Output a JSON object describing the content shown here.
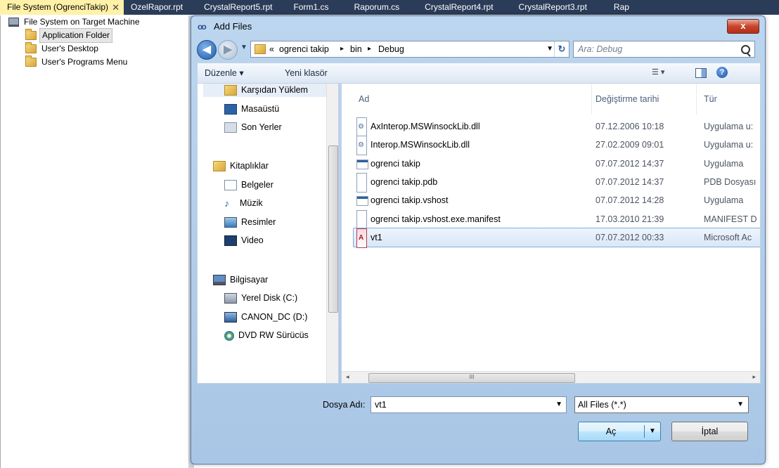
{
  "tabs": [
    {
      "label": "File System (OgrenciTakip)",
      "active": true
    },
    {
      "label": "OzelRapor.rpt"
    },
    {
      "label": "CrystalReport5.rpt"
    },
    {
      "label": "Form1.cs"
    },
    {
      "label": "Raporum.cs"
    },
    {
      "label": "CrystalReport4.rpt"
    },
    {
      "label": "CrystalReport3.rpt"
    },
    {
      "label": "Rap"
    }
  ],
  "tab_close_glyph": "✕",
  "tree": {
    "root": "File System on Target Machine",
    "items": [
      "Application Folder",
      "User's Desktop",
      "User's Programs Menu"
    ],
    "selected_index": 0
  },
  "dialog": {
    "title": "Add Files",
    "title_icon_glyph": "oo",
    "close_glyph": "x",
    "back_glyph": "◀",
    "forward_glyph": "▶",
    "breadcrumb": [
      "«",
      "ogrenci takip",
      "▸",
      "bin",
      "▸",
      "Debug"
    ],
    "search_placeholder": "Ara: Debug",
    "refresh_glyph": "↻",
    "command_bar": {
      "organize": "Düzenle ▾",
      "new_folder": "Yeni klasör",
      "views_glyph": "☰ ▾",
      "help_glyph": "?"
    },
    "nav_pane": [
      {
        "label": "Karşıdan Yüklem",
        "icon": "downloads-folder",
        "selected": true
      },
      {
        "label": "Masaüstü",
        "icon": "desktop"
      },
      {
        "label": "Son Yerler",
        "icon": "recent-places"
      },
      {
        "label": "Kitaplıklar",
        "icon": "libraries"
      },
      {
        "label": "Belgeler",
        "icon": "documents"
      },
      {
        "label": "Müzik",
        "icon": "music"
      },
      {
        "label": "Resimler",
        "icon": "pictures"
      },
      {
        "label": "Video",
        "icon": "video"
      },
      {
        "label": "Bilgisayar",
        "icon": "computer"
      },
      {
        "label": "Yerel Disk (C:)",
        "icon": "local-disk"
      },
      {
        "label": "CANON_DC (D:)",
        "icon": "network-drive"
      },
      {
        "label": "DVD RW Sürücüs",
        "icon": "dvd-drive"
      }
    ],
    "columns": [
      "Ad",
      "Değiştirme tarihi",
      "Tür"
    ],
    "files": [
      {
        "name": "AxInterop.MSWinsockLib.dll",
        "date": "07.12.2006 10:18",
        "type": "Uygulama u:",
        "icon": "dll"
      },
      {
        "name": "Interop.MSWinsockLib.dll",
        "date": "27.02.2009 09:01",
        "type": "Uygulama u:",
        "icon": "dll"
      },
      {
        "name": "ogrenci takip",
        "date": "07.07.2012 14:37",
        "type": "Uygulama",
        "icon": "exe"
      },
      {
        "name": "ogrenci takip.pdb",
        "date": "07.07.2012 14:37",
        "type": "PDB Dosyası",
        "icon": "blank"
      },
      {
        "name": "ogrenci takip.vshost",
        "date": "07.07.2012 14:28",
        "type": "Uygulama",
        "icon": "exe"
      },
      {
        "name": "ogrenci takip.vshost.exe.manifest",
        "date": "17.03.2010 21:39",
        "type": "MANIFEST D",
        "icon": "blank"
      },
      {
        "name": "vt1",
        "date": "07.07.2012 00:33",
        "type": "Microsoft Ac",
        "icon": "access",
        "selected": true
      }
    ],
    "scroll_left_glyph": "◂",
    "scroll_right_glyph": "▸",
    "scroll_thumb_glyph": "III",
    "filename_label": "Dosya Adı:",
    "filename_value": "vt1",
    "filetype_value": "All Files (*.*)",
    "open_label": "Aç",
    "cancel_label": "İptal",
    "dropdown_glyph": "▼",
    "grip_glyph": "⋰"
  }
}
